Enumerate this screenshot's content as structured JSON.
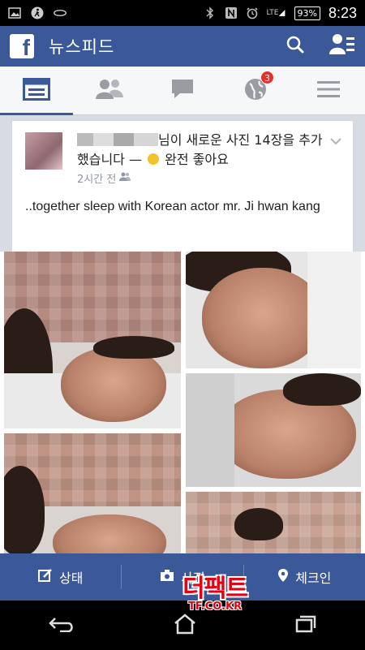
{
  "status_bar": {
    "network": "LTE",
    "battery": "93%",
    "time": "8:23"
  },
  "header": {
    "logo": "f",
    "title": "뉴스피드"
  },
  "tabs": {
    "notifications_badge": "3"
  },
  "post": {
    "header_text": "님이 새로운 사진 14장을 추가했습니다 — ",
    "feeling": "완전 좋아요",
    "time": "2시간 전",
    "body": "..together sleep with Korean actor mr. Ji hwan kang"
  },
  "composer": {
    "status_label": "상태",
    "photo_label": "사진",
    "checkin_label": "체크인"
  },
  "watermark": {
    "main": "더팩트",
    "sub": "TF.CO.KR"
  },
  "colors": {
    "facebook_blue": "#3b5998",
    "badge_red": "#e0312b",
    "watermark_red": "#e60012"
  }
}
